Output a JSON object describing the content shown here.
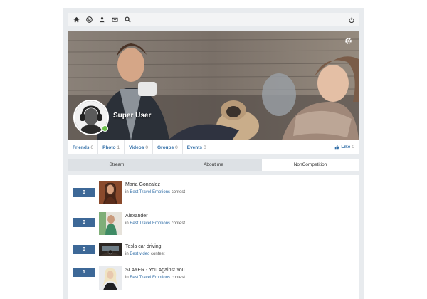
{
  "topbar": {
    "icons": [
      "home-icon",
      "globe-icon",
      "users-icon",
      "envelope-icon",
      "search-icon"
    ],
    "right_icon": "power-icon"
  },
  "profile": {
    "name": "Super User",
    "status_color": "#6bc04b"
  },
  "stats": [
    {
      "label": "Friends",
      "count": "0"
    },
    {
      "label": "Photo",
      "count": "1"
    },
    {
      "label": "Videos",
      "count": "0"
    },
    {
      "label": "Groups",
      "count": "0"
    },
    {
      "label": "Events",
      "count": "0"
    }
  ],
  "like": {
    "label": "Like",
    "count": "0"
  },
  "tabs": [
    {
      "label": "Stream",
      "active": false
    },
    {
      "label": "About me",
      "active": false
    },
    {
      "label": "NonCompetition",
      "active": true
    }
  ],
  "entries": [
    {
      "votes": "0",
      "title": "Maria Gonzalez",
      "prefix": "in",
      "contest": "Best Travel Emotions",
      "suffix": "contest"
    },
    {
      "votes": "0",
      "title": "Alexander",
      "prefix": "in",
      "contest": "Best Travel Emotions",
      "suffix": "contest"
    },
    {
      "votes": "0",
      "title": "Tesla car driving",
      "prefix": "in",
      "contest": "Best video",
      "suffix": "contest"
    },
    {
      "votes": "1",
      "title": "SLAYER - You Against You",
      "prefix": "in",
      "contest": "Best Travel Emotions",
      "suffix": "contest"
    }
  ],
  "colors": {
    "accent": "#3470a8",
    "badge": "#3d6897",
    "frame": "#e8ebee",
    "tab_inactive": "#dde1e5"
  }
}
